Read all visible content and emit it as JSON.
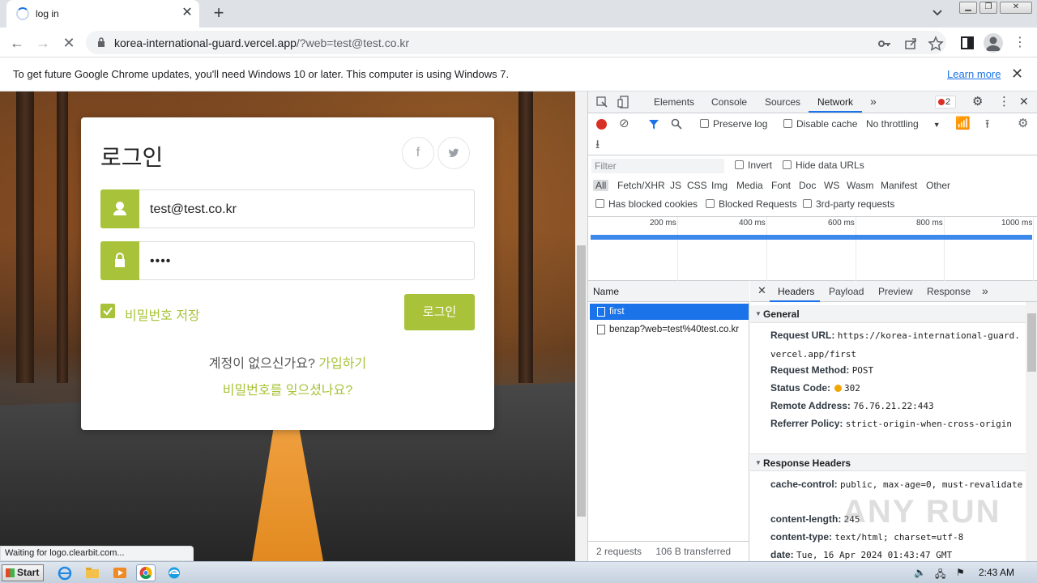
{
  "browser": {
    "tab_title": "log in",
    "url_host": "korea-international-guard.vercel.app",
    "url_path": "/?web=test@test.co.kr",
    "infobar_message": "To get future Google Chrome updates, you'll need Windows 10 or later. This computer is using Windows 7.",
    "infobar_link": "Learn more",
    "status_text": "Waiting for logo.clearbit.com..."
  },
  "login": {
    "heading": "로그인",
    "email_value": "test@test.co.kr",
    "password_value": "••••",
    "remember_label": "비밀번호 저장",
    "login_button": "로그인",
    "no_account_text": "계정이 없으신가요?",
    "signup_link": "가입하기",
    "forgot_link": "비밀번호를 잊으셨나요?",
    "accent_color": "#a8c33a"
  },
  "devtools": {
    "tabs": [
      "Elements",
      "Console",
      "Sources",
      "Network"
    ],
    "active_tab": "Network",
    "error_count": "2",
    "toolbar": {
      "preserve_log": "Preserve log",
      "disable_cache": "Disable cache",
      "throttling": "No throttling"
    },
    "filter_placeholder": "Filter",
    "invert": "Invert",
    "hide_data_urls": "Hide data URLs",
    "filter_types": [
      "All",
      "Fetch/XHR",
      "JS",
      "CSS",
      "Img",
      "Media",
      "Font",
      "Doc",
      "WS",
      "Wasm",
      "Manifest",
      "Other"
    ],
    "has_blocked_cookies": "Has blocked cookies",
    "blocked_requests": "Blocked Requests",
    "third_party": "3rd-party requests",
    "timeline_ticks": [
      "200 ms",
      "400 ms",
      "600 ms",
      "800 ms",
      "1000 ms"
    ],
    "name_header": "Name",
    "requests": [
      "first",
      "benzap?web=test%40test.co.kr"
    ],
    "footer_requests": "2 requests",
    "footer_transferred": "106 B transferred",
    "detail_tabs": [
      "Headers",
      "Payload",
      "Preview",
      "Response"
    ],
    "general_title": "General",
    "general": {
      "request_url_key": "Request URL:",
      "request_url": "https://korea-international-guard.vercel.app/first",
      "method_key": "Request Method:",
      "method": "POST",
      "status_key": "Status Code:",
      "status": "302",
      "remote_key": "Remote Address:",
      "remote": "76.76.21.22:443",
      "referrer_key": "Referrer Policy:",
      "referrer": "strict-origin-when-cross-origin"
    },
    "response_headers_title": "Response Headers",
    "response_headers": {
      "cache_key": "cache-control:",
      "cache": "public, max-age=0, must-revalidate",
      "length_key": "content-length:",
      "length": "245",
      "type_key": "content-type:",
      "type": "text/html; charset=utf-8",
      "date_key": "date:",
      "date": "Tue, 16 Apr 2024 01:43:47 GMT"
    }
  },
  "watermark": "ANY RUN",
  "taskbar": {
    "start_label": "Start",
    "clock": "2:43 AM"
  }
}
